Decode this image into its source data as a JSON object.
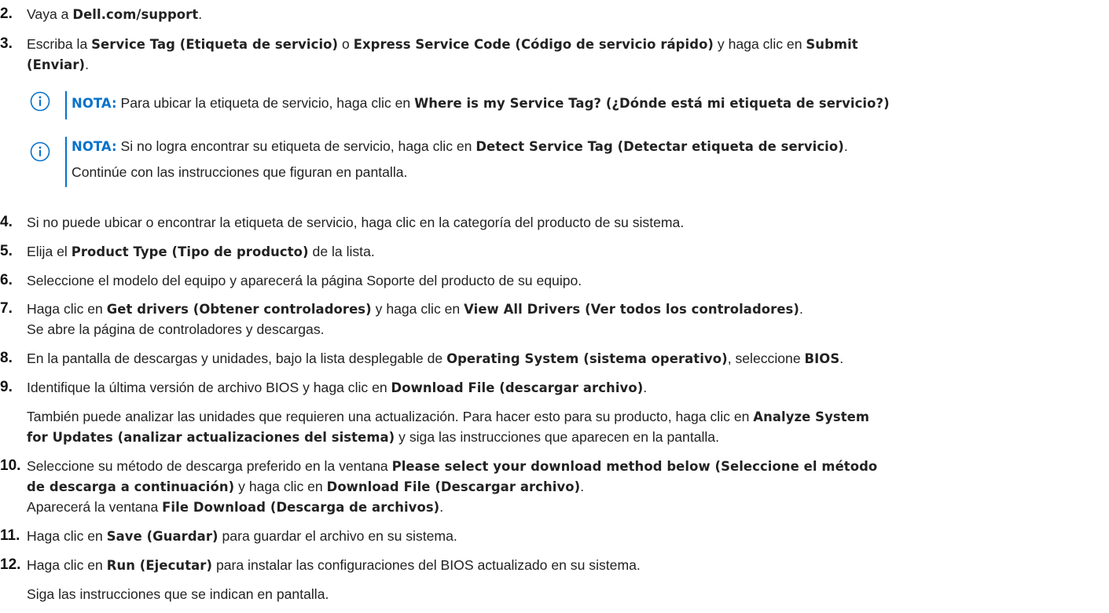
{
  "steps": [
    {
      "num": "2.",
      "parts": [
        [
          "t",
          "Vaya a "
        ],
        [
          "b",
          "Dell.com/support"
        ],
        [
          "t",
          "."
        ]
      ]
    },
    {
      "num": "3.",
      "parts": [
        [
          "t",
          "Escriba la "
        ],
        [
          "b",
          "Service Tag (Etiqueta de servicio)"
        ],
        [
          "t",
          " o "
        ],
        [
          "b",
          "Express Service Code (Código de servicio rápido)"
        ],
        [
          "t",
          " y haga clic en "
        ],
        [
          "b",
          "Submit"
        ]
      ],
      "parts2": [
        [
          "b",
          "(Enviar)"
        ],
        [
          "t",
          "."
        ]
      ]
    },
    {
      "num": "4.",
      "parts": [
        [
          "t",
          "Si no puede ubicar o encontrar la etiqueta de servicio, haga clic en la categoría del producto de su sistema."
        ]
      ]
    },
    {
      "num": "5.",
      "parts": [
        [
          "t",
          "Elija el "
        ],
        [
          "b",
          "Product Type (Tipo de producto)"
        ],
        [
          "t",
          " de la lista."
        ]
      ]
    },
    {
      "num": "6.",
      "parts": [
        [
          "t",
          "Seleccione el modelo del equipo y aparecerá la página Soporte del producto de su equipo."
        ]
      ]
    },
    {
      "num": "7.",
      "parts": [
        [
          "t",
          "Haga clic en "
        ],
        [
          "b",
          "Get drivers (Obtener controladores)"
        ],
        [
          "t",
          " y haga clic en "
        ],
        [
          "b",
          "View All Drivers (Ver todos los controladores)"
        ],
        [
          "t",
          "."
        ]
      ],
      "parts2": [
        [
          "t",
          "Se abre la página de controladores y descargas."
        ]
      ]
    },
    {
      "num": "8.",
      "parts": [
        [
          "t",
          "En la pantalla de descargas y unidades, bajo la lista desplegable de "
        ],
        [
          "b",
          "Operating System (sistema operativo)"
        ],
        [
          "t",
          ", seleccione "
        ],
        [
          "b",
          "BIOS"
        ],
        [
          "t",
          "."
        ]
      ]
    },
    {
      "num": "9.",
      "parts": [
        [
          "t",
          "Identifique la última versión de archivo BIOS y haga clic en "
        ],
        [
          "b",
          "Download File (descargar archivo)"
        ],
        [
          "t",
          "."
        ]
      ],
      "extra1": [
        [
          "t",
          "También puede analizar las unidades que requieren una actualización. Para hacer esto para su producto, haga clic en "
        ],
        [
          "b",
          "Analyze System"
        ]
      ],
      "extra2": [
        [
          "b",
          "for Updates (analizar actualizaciones del sistema)"
        ],
        [
          "t",
          " y siga las instrucciones que aparecen en la pantalla."
        ]
      ]
    },
    {
      "num": "10.",
      "parts": [
        [
          "t",
          "Seleccione su método de descarga preferido en la ventana "
        ],
        [
          "b",
          "Please select your download method below (Seleccione el método"
        ]
      ],
      "parts2": [
        [
          "b",
          "de descarga a continuación)"
        ],
        [
          "t",
          " y haga clic en "
        ],
        [
          "b",
          "Download File (Descargar archivo)"
        ],
        [
          "t",
          "."
        ]
      ],
      "parts3": [
        [
          "t",
          "Aparecerá la ventana "
        ],
        [
          "b",
          "File Download (Descarga de archivos)"
        ],
        [
          "t",
          "."
        ]
      ]
    },
    {
      "num": "11.",
      "parts": [
        [
          "t",
          "Haga clic en "
        ],
        [
          "b",
          "Save (Guardar)"
        ],
        [
          "t",
          " para guardar el archivo en su sistema."
        ]
      ]
    },
    {
      "num": "12.",
      "parts": [
        [
          "t",
          "Haga clic en "
        ],
        [
          "b",
          "Run (Ejecutar)"
        ],
        [
          "t",
          " para instalar las configuraciones del BIOS actualizado en su sistema."
        ]
      ],
      "extra1": [
        [
          "t",
          "Siga las instrucciones que se indican en pantalla."
        ]
      ]
    }
  ],
  "notes": [
    {
      "label": "NOTA:",
      "parts": [
        [
          "t",
          " Para ubicar la etiqueta de servicio, haga clic en "
        ],
        [
          "b",
          "Where is my Service Tag? (¿Dónde está mi etiqueta de servicio?)"
        ]
      ]
    },
    {
      "label": "NOTA:",
      "parts": [
        [
          "t",
          " Si no logra encontrar su etiqueta de servicio, haga clic en "
        ],
        [
          "b",
          "Detect Service Tag (Detectar etiqueta de servicio)"
        ],
        [
          "t",
          "."
        ]
      ],
      "parts2": [
        [
          "t",
          "Continúe con las instrucciones que figuran en pantalla."
        ]
      ]
    }
  ],
  "colors": {
    "accent": "#0672cb",
    "text": "#222222"
  },
  "icons": {
    "note": "info-circle-icon"
  }
}
